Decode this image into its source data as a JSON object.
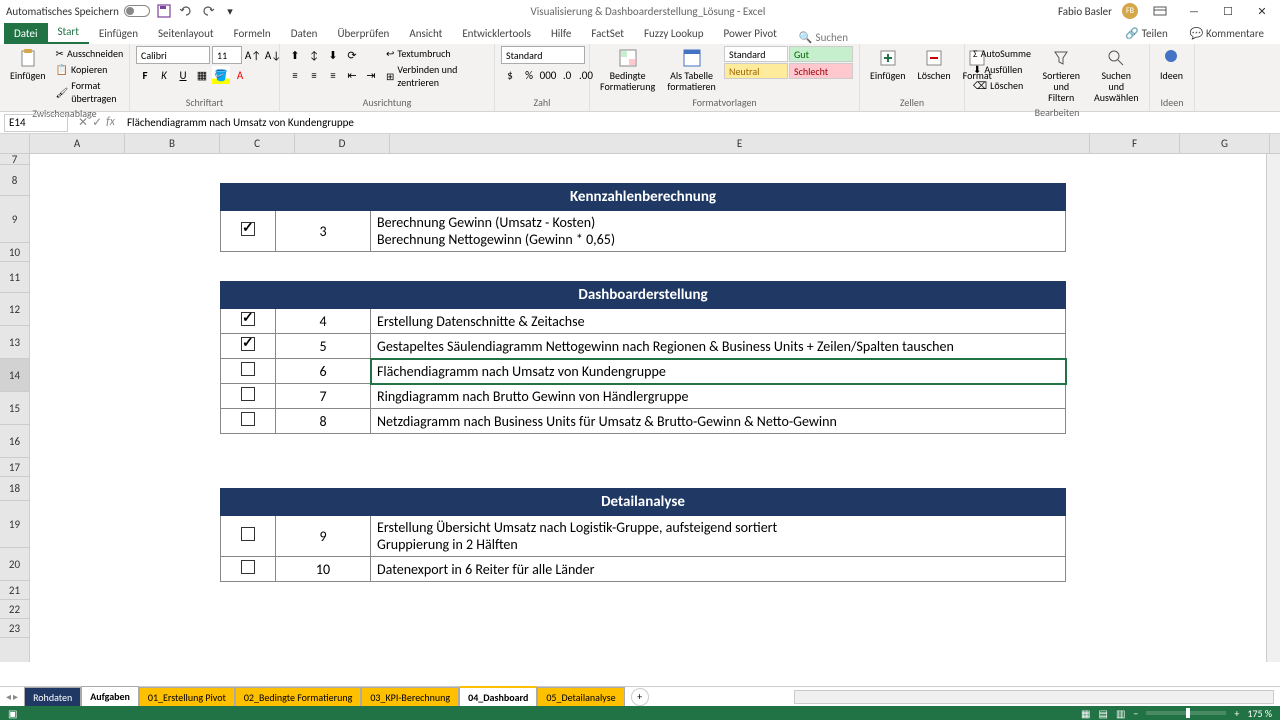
{
  "titlebar": {
    "autosave": "Automatisches Speichern",
    "title": "Visualisierung & Dashboarderstellung_Lösung - Excel",
    "user": "Fabio Basler",
    "badge": "FB"
  },
  "tabs": {
    "file": "Datei",
    "start": "Start",
    "einfugen": "Einfügen",
    "seitenlayout": "Seitenlayout",
    "formeln": "Formeln",
    "daten": "Daten",
    "uberprufen": "Überprüfen",
    "ansicht": "Ansicht",
    "entwicklertools": "Entwicklertools",
    "hilfe": "Hilfe",
    "factset": "FactSet",
    "fuzzy": "Fuzzy Lookup",
    "powerpivot": "Power Pivot",
    "search": "Suchen",
    "teilen": "Teilen",
    "kommentare": "Kommentare"
  },
  "ribbon": {
    "zwischenablage": "Zwischenablage",
    "einfugen": "Einfügen",
    "ausschneiden": "Ausschneiden",
    "kopieren": "Kopieren",
    "format_ubertragen": "Format übertragen",
    "schriftart": "Schriftart",
    "font": "Calibri",
    "size": "11",
    "ausrichtung": "Ausrichtung",
    "textumbruch": "Textumbruch",
    "verbinden": "Verbinden und zentrieren",
    "zahl": "Zahl",
    "num_format": "Standard",
    "formatvorlagen": "Formatvorlagen",
    "bedingte": "Bedingte Formatierung",
    "als_tabelle": "Als Tabelle formatieren",
    "style_standard": "Standard",
    "style_neutral": "Neutral",
    "style_gut": "Gut",
    "style_schlecht": "Schlecht",
    "zellen": "Zellen",
    "einfugen2": "Einfügen",
    "loschen": "Löschen",
    "format": "Format",
    "bearbeiten": "Bearbeiten",
    "autosumme": "AutoSumme",
    "ausfullen": "Ausfüllen",
    "loschen2": "Löschen",
    "sortieren": "Sortieren und Filtern",
    "suchen": "Suchen und Auswählen",
    "ideen": "Ideen"
  },
  "formula": {
    "cell_ref": "E14",
    "content": "Flächendiagramm nach Umsatz von Kundengruppe"
  },
  "cols": [
    "A",
    "B",
    "C",
    "D",
    "E",
    "F",
    "G"
  ],
  "rows": [
    "7",
    "8",
    "9",
    "10",
    "11",
    "12",
    "13",
    "14",
    "15",
    "16",
    "17",
    "18",
    "19",
    "20",
    "21",
    "22",
    "23"
  ],
  "sections": {
    "s1_title": "Kennzahlenberechnung",
    "s1_r1_num": "3",
    "s1_r1_txt1": "Berechnung Gewinn (Umsatz - Kosten)",
    "s1_r1_txt2": "Berechnung Nettogewinn (Gewinn * 0,65)",
    "s2_title": "Dashboarderstellung",
    "s2_r1_num": "4",
    "s2_r1_txt": "Erstellung Datenschnitte & Zeitachse",
    "s2_r2_num": "5",
    "s2_r2_txt": "Gestapeltes Säulendiagramm Nettogewinn nach Regionen & Business Units + Zeilen/Spalten tauschen",
    "s2_r3_num": "6",
    "s2_r3_txt": "Flächendiagramm nach Umsatz von Kundengruppe",
    "s2_r4_num": "7",
    "s2_r4_txt": "Ringdiagramm nach Brutto Gewinn von Händlergruppe",
    "s2_r5_num": "8",
    "s2_r5_txt": "Netzdiagramm nach Business Units für Umsatz & Brutto-Gewinn & Netto-Gewinn",
    "s3_title": "Detailanalyse",
    "s3_r1_num": "9",
    "s3_r1_txt1": "Erstellung Übersicht Umsatz nach Logistik-Gruppe, aufsteigend sortiert",
    "s3_r1_txt2": "Gruppierung in 2 Hälften",
    "s3_r2_num": "10",
    "s3_r2_txt": "Datenexport in 6 Reiter für alle Länder"
  },
  "sheets": {
    "rohdaten": "Rohdaten",
    "aufgaben": "Aufgaben",
    "s01": "01_Erstellung Pivot",
    "s02": "02_Bedingte Formatierung",
    "s03": "03_KPI-Berechnung",
    "s04": "04_Dashboard",
    "s05": "05_Detailanalyse"
  },
  "status": {
    "zoom": "175 %"
  }
}
